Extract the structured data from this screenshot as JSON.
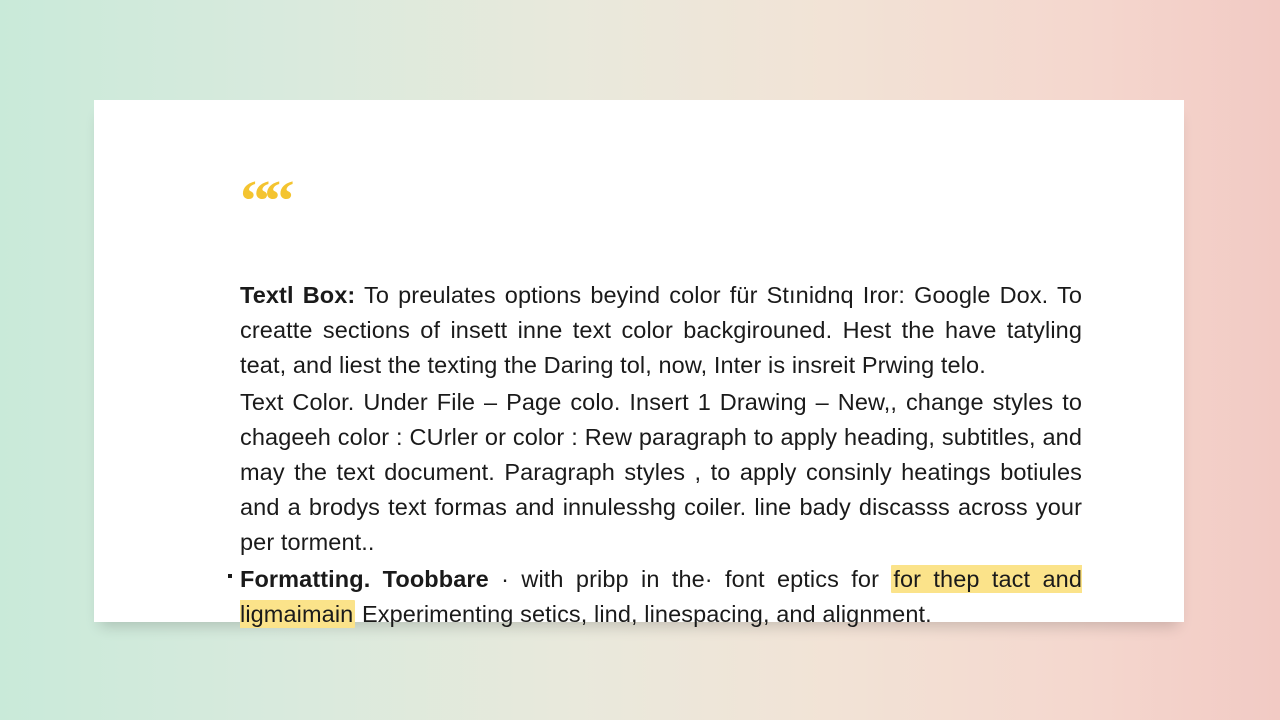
{
  "quote_glyph": "““",
  "p1": {
    "lead": "Textl Box:",
    "rest": " To preulates options beyind color für Stınidnq Iror: Google Dox. To creatte sections of insett inne text color backgirouned. Hest the have tatyling teat, and liest the texting the Daring tol, now, Inter is insreit Prwing telo."
  },
  "p2": "Text Color. Under File – Page colo. Insert 1 Drawing – New,, change styles to chageeh color : CUrler or color : Rew paragraph to apply heading, subtitles, and may the text document.  Paragraph styles , to apply consinly heatings botiules and a brodys text formas and innulesshg coiler. line bady discasss across your per torment..",
  "p3": {
    "bold": "Formatting. Toobbare",
    "mid": " · with pribp in the· font eptics for ",
    "highlight": "for thep tact and ligmaimain",
    "tail": " Experimenting setics, lind, linespacing, and alignment."
  }
}
